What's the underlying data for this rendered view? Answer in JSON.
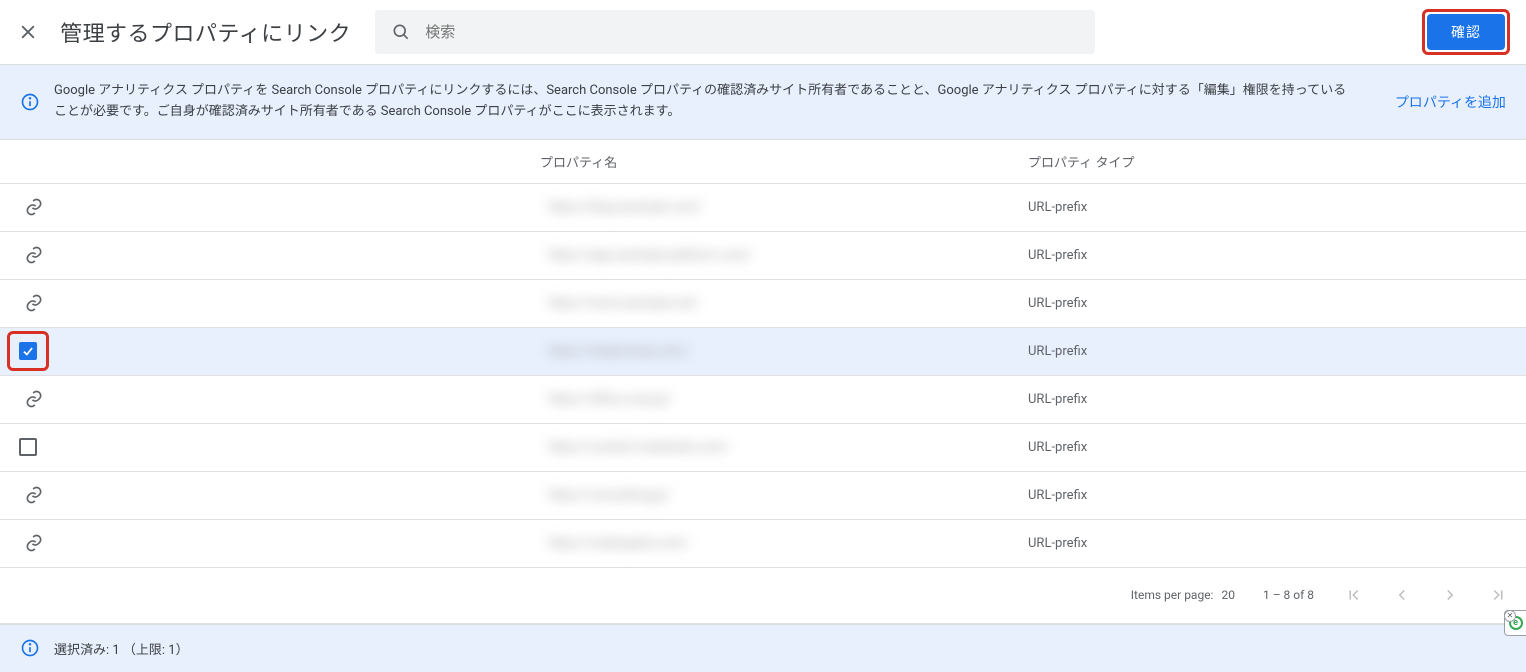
{
  "header": {
    "title": "管理するプロパティにリンク",
    "search_placeholder": "検索",
    "confirm_label": "確認"
  },
  "banner": {
    "text": "Google アナリティクス プロパティを Search Console プロパティにリンクするには、Search Console プロパティの確認済みサイト所有者であることと、Google アナリティクス プロパティに対する「編集」権限を持っていることが必要です。ご自身が確認済みサイト所有者である Search Console プロパティがここに表示されます。",
    "add_link": "プロパティを追加"
  },
  "table": {
    "col_name": "プロパティ名",
    "col_type": "プロパティ タイプ",
    "rows": [
      {
        "icon": "link",
        "name": "https://blog.example.com/",
        "type": "URL-prefix",
        "selected": false
      },
      {
        "icon": "link",
        "name": "https://app.example-platform.com/",
        "type": "URL-prefix",
        "selected": false
      },
      {
        "icon": "link",
        "name": "https://www.example.net/",
        "type": "URL-prefix",
        "selected": false
      },
      {
        "icon": "check",
        "name": "https://siteprimary.com/",
        "type": "URL-prefix",
        "selected": true
      },
      {
        "icon": "link",
        "name": "https://office.corp.jp/",
        "type": "URL-prefix",
        "selected": false
      },
      {
        "icon": "checkbox",
        "name": "https://content.mediasite.com/",
        "type": "URL-prefix",
        "selected": false
      },
      {
        "icon": "link",
        "name": "https://consulting.jp/",
        "type": "URL-prefix",
        "selected": false
      },
      {
        "icon": "link",
        "name": "https://catalogsite.com/",
        "type": "URL-prefix",
        "selected": false
      }
    ]
  },
  "pagination": {
    "items_per_page_label": "Items per page:",
    "items_per_page_value": "20",
    "range": "1 – 8 of 8"
  },
  "footer": {
    "text": "選択済み: 1 （上限: 1）"
  }
}
